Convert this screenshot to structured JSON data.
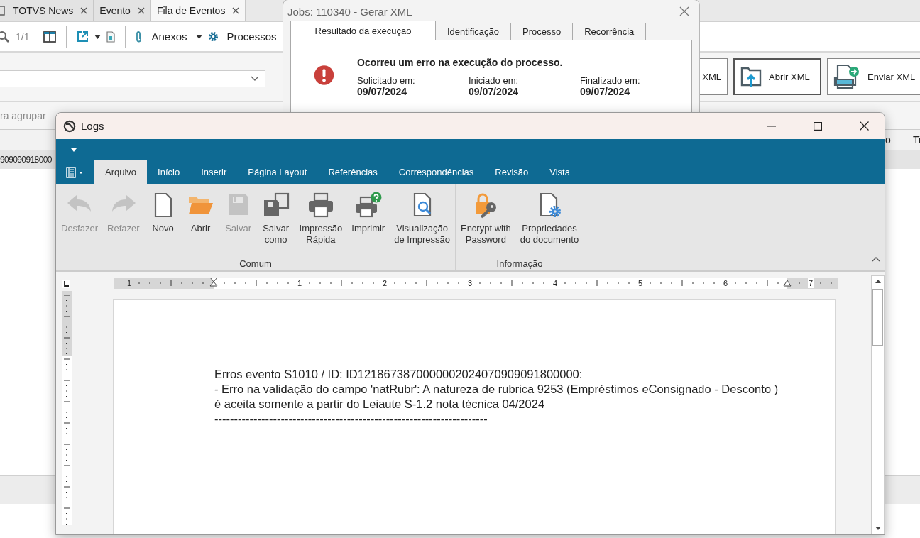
{
  "app": {
    "tabs": [
      {
        "label": "TOTVS News",
        "selected": false
      },
      {
        "label": "Evento",
        "selected": false
      },
      {
        "label": "Fila de Eventos",
        "selected": true
      }
    ],
    "toolbar": {
      "page": "1/1",
      "attachments": "Anexos",
      "processes": "Processos"
    },
    "actions": [
      {
        "label": "XML",
        "kind": "plain",
        "focused": false
      },
      {
        "label": "Abrir XML",
        "kind": "open",
        "focused": true
      },
      {
        "label": "Enviar XML",
        "kind": "send",
        "focused": false
      }
    ],
    "group_hint": "ra agrupar",
    "columns": [
      "o",
      "Ti"
    ],
    "row_cell": "909090918000"
  },
  "job_dialog": {
    "title": "Jobs: 110340 - Gerar XML",
    "tabs": [
      {
        "label": "Resultado da execução",
        "selected": true
      },
      {
        "label": "Identificação",
        "selected": false
      },
      {
        "label": "Processo",
        "selected": false
      },
      {
        "label": "Recorrência",
        "selected": false
      }
    ],
    "message": "Ocorreu um erro na execução do processo.",
    "dates": [
      {
        "label": "Solicitado em:",
        "value": "09/07/2024"
      },
      {
        "label": "Iniciado em:",
        "value": "09/07/2024"
      },
      {
        "label": "Finalizado em:",
        "value": "09/07/2024"
      }
    ]
  },
  "logs_window": {
    "title": "Logs",
    "ribbon_tabs": [
      {
        "label": "Arquivo",
        "selected": true
      },
      {
        "label": "Início",
        "selected": false
      },
      {
        "label": "Inserir",
        "selected": false
      },
      {
        "label": "Página Layout",
        "selected": false
      },
      {
        "label": "Referências",
        "selected": false
      },
      {
        "label": "Correspondências",
        "selected": false
      },
      {
        "label": "Revisão",
        "selected": false
      },
      {
        "label": "Vista",
        "selected": false
      }
    ],
    "groups": [
      {
        "label": "Comum",
        "buttons": [
          {
            "lines": [
              "Desfazer"
            ],
            "kind": "undo",
            "disabled": true
          },
          {
            "lines": [
              "Refazer"
            ],
            "kind": "redo",
            "disabled": true
          },
          {
            "lines": [
              "Novo"
            ],
            "kind": "new",
            "disabled": false
          },
          {
            "lines": [
              "Abrir"
            ],
            "kind": "open",
            "disabled": false
          },
          {
            "lines": [
              "Salvar"
            ],
            "kind": "save",
            "disabled": true
          },
          {
            "lines": [
              "Salvar",
              "como"
            ],
            "kind": "saveas",
            "disabled": false
          },
          {
            "lines": [
              "Impressão",
              "Rápida"
            ],
            "kind": "quickprint",
            "disabled": false
          },
          {
            "lines": [
              "Imprimir"
            ],
            "kind": "print",
            "disabled": false
          },
          {
            "lines": [
              "Visualização",
              "de Impressão"
            ],
            "kind": "preview",
            "disabled": false
          }
        ]
      },
      {
        "label": "Informação",
        "buttons": [
          {
            "lines": [
              "Encrypt with",
              "Password"
            ],
            "kind": "encrypt",
            "disabled": false
          },
          {
            "lines": [
              "Propriedades",
              "do documento"
            ],
            "kind": "properties",
            "disabled": false
          }
        ]
      }
    ],
    "ruler_numbers": [
      "1",
      "1",
      "2",
      "3",
      "4",
      "5",
      "6",
      "7"
    ],
    "document_lines": [
      "Erros evento S1010 / ID: ID1218673870000002024070909091800000:",
      "- Erro na validação do campo 'natRubr': A natureza de rubrica 9253 (Empréstimos eConsignado - Desconto )",
      "é aceita somente a partir do Leiaute S-1.2 nota técnica 04/2024",
      "----------------------------------------------------------------------"
    ]
  }
}
